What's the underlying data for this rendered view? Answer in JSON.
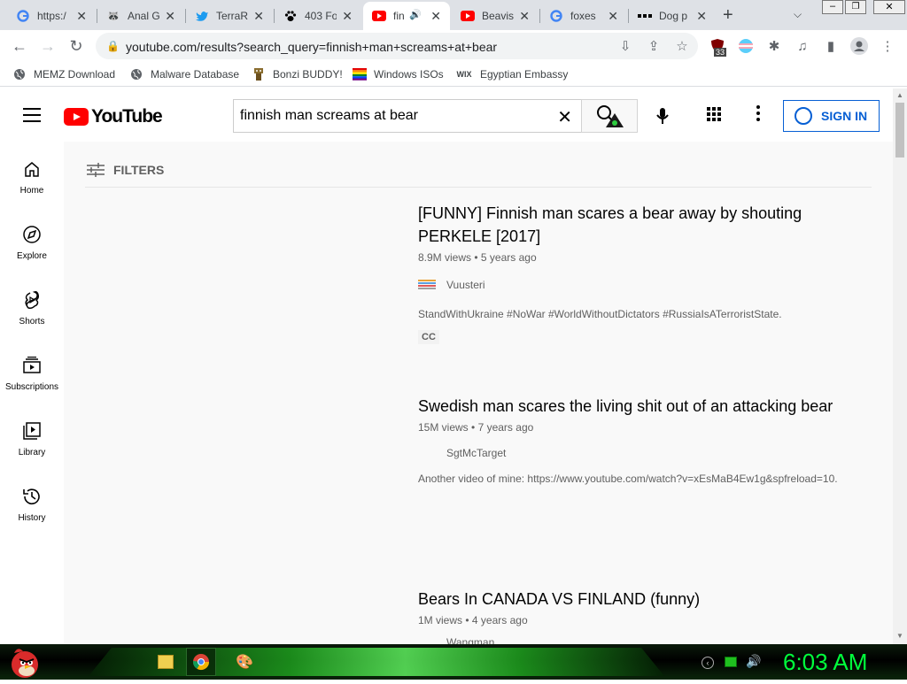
{
  "browser": {
    "tabs": [
      {
        "label": "https:/",
        "icon": "google-icon",
        "active": false
      },
      {
        "label": "Anal G",
        "icon": "raccoon-icon",
        "active": false
      },
      {
        "label": "TerraR",
        "icon": "twitter-icon",
        "active": false
      },
      {
        "label": "403 Fo",
        "icon": "paw-icon",
        "active": false
      },
      {
        "label": "fin",
        "icon": "youtube-icon",
        "active": true
      },
      {
        "label": "Beavis",
        "icon": "youtube-icon",
        "active": false
      },
      {
        "label": "foxes",
        "icon": "google-icon",
        "active": false
      },
      {
        "label": "Dog p",
        "icon": "dots-icon",
        "active": false
      }
    ],
    "url": "youtube.com/results?search_query=finnish+man+screams+at+bear",
    "extension_badge": "33",
    "bookmarks": [
      {
        "label": "MEMZ Download",
        "icon": "globe-icon"
      },
      {
        "label": "Malware Database",
        "icon": "globe-icon"
      },
      {
        "label": "Bonzi BUDDY!",
        "icon": "bonzi-icon"
      },
      {
        "label": "Windows ISOs",
        "icon": "windows-icon"
      },
      {
        "label": "Egyptian Embassy",
        "icon": "wix-icon"
      }
    ],
    "wix_logo": "WIX"
  },
  "youtube": {
    "logo": "YouTube",
    "search_query": "finnish man screams at bear",
    "sign_in": "SIGN IN",
    "sidebar": [
      {
        "label": "Home",
        "icon": "home-icon"
      },
      {
        "label": "Explore",
        "icon": "compass-icon"
      },
      {
        "label": "Shorts",
        "icon": "shorts-icon"
      },
      {
        "label": "Subscriptions",
        "icon": "subscriptions-icon"
      },
      {
        "label": "Library",
        "icon": "library-icon"
      },
      {
        "label": "History",
        "icon": "history-icon"
      }
    ],
    "filters_label": "FILTERS",
    "results": [
      {
        "title": "[FUNNY] Finnish man scares a bear away by shouting PERKELE [2017]",
        "views": "8.9M views",
        "age": "5 years ago",
        "channel": "Vuusteri",
        "description": "StandWithUkraine #NoWar #WorldWithoutDictators #RussiaIsATerroristState.",
        "badge": "CC"
      },
      {
        "title": "Swedish man scares the living shit out of an attacking bear",
        "views": "15M views",
        "age": "7 years ago",
        "channel": "SgtMcTarget",
        "description": "Another video of mine: https://www.youtube.com/watch?v=xEsMaB4Ew1g&spfreload=10."
      },
      {
        "title": "Bears In CANADA VS FINLAND (funny)",
        "views": "1M views",
        "age": "4 years ago",
        "channel": "Wangman"
      }
    ],
    "meta_separator": "•"
  },
  "taskbar": {
    "clock": "6:03 AM"
  },
  "colors": {
    "yt_red": "#ff0000",
    "yt_blue": "#065fd4",
    "clock_green": "#00ff3c"
  }
}
